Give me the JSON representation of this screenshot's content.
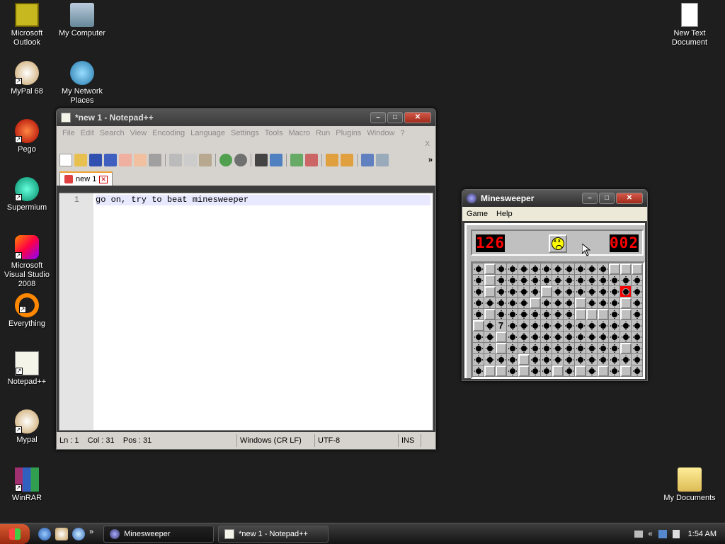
{
  "desktop": {
    "icons": [
      {
        "label": "Microsoft Outlook"
      },
      {
        "label": "My Computer"
      },
      {
        "label": "MyPal 68"
      },
      {
        "label": "My Network Places"
      },
      {
        "label": "Pego"
      },
      {
        "label": "Supermium"
      },
      {
        "label": "Microsoft Visual Studio 2008"
      },
      {
        "label": "Everything"
      },
      {
        "label": "Notepad++"
      },
      {
        "label": "Mypal"
      },
      {
        "label": "WinRAR"
      },
      {
        "label": "New Text Document"
      },
      {
        "label": "My Documents"
      }
    ]
  },
  "notepad": {
    "title": "*new 1 - Notepad++",
    "menu": [
      "File",
      "Edit",
      "Search",
      "View",
      "Encoding",
      "Language",
      "Settings",
      "Tools",
      "Macro",
      "Run",
      "Plugins",
      "Window",
      "?"
    ],
    "close_doc": "X",
    "tab_label": "new 1",
    "line_number": "1",
    "line_text": "go on, try to beat minesweeper",
    "status": {
      "position": "Ln : 1    Col : 31    Pos : 31",
      "eol": "Windows (CR LF)",
      "encoding": "UTF-8",
      "mode": "INS"
    }
  },
  "minesweeper": {
    "title": "Minesweeper",
    "menu": [
      "Game",
      "Help"
    ],
    "mines_counter": "126",
    "timer": "002",
    "face": "dead-face-icon",
    "number_cell": "7",
    "grid_rows": [
      "MRMMMMMMMMMMRRR",
      "MRMMMMMMMMMMMMM",
      "MRMMMMRMMMMMMXM",
      "MMMMMRMMMRMMMRM",
      "MRMMMMMMMRRRMRM",
      "RM7MMMMMMMMMMMM",
      "MMRMMMMMMMMMMMM",
      "MMRMMMMMMMMMMRM",
      "MMMMRMMMMMMMMMM",
      "MRRMRMMRMRMRMRM"
    ]
  },
  "taskbar": {
    "tasks": [
      {
        "label": "Minesweeper"
      },
      {
        "label": "*new 1 - Notepad++"
      }
    ],
    "clock": "1:54 AM",
    "more": "»",
    "tray_more": "«"
  }
}
